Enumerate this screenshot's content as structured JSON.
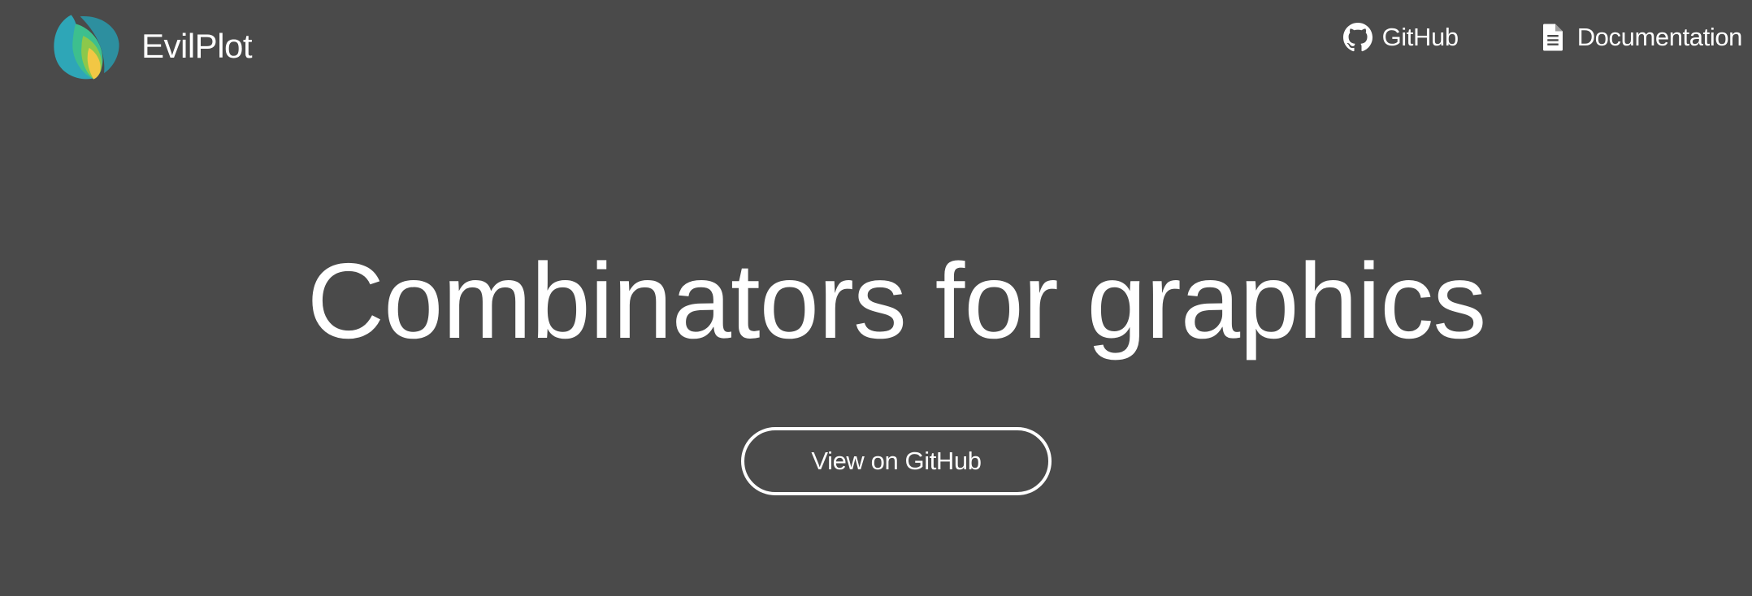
{
  "header": {
    "brand": {
      "name": "EvilPlot",
      "logo_icon": "evilplot-leaf-logo",
      "logo_colors": [
        "#2ea6b7",
        "#3dbf8e",
        "#8cc84b",
        "#f2c744"
      ]
    },
    "nav": [
      {
        "label": "GitHub",
        "icon": "github-icon"
      },
      {
        "label": "Documentation",
        "icon": "document-icon"
      }
    ]
  },
  "hero": {
    "title": "Combinators for graphics",
    "cta_label": "View on GitHub"
  },
  "colors": {
    "background": "#4a4a4a",
    "text": "#ffffff"
  }
}
